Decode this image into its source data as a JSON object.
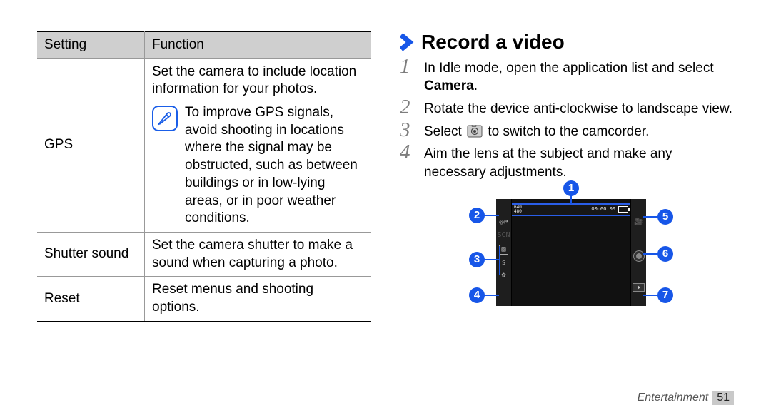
{
  "table": {
    "header_setting": "Setting",
    "header_function": "Function",
    "rows": {
      "gps": {
        "setting": "GPS",
        "func_line": "Set the camera to include location information for your photos.",
        "note": "To improve GPS signals, avoid shooting in locations where the signal may be obstructed, such as between buildings or in low-lying areas, or in poor weather conditions."
      },
      "shutter": {
        "setting": "Shutter sound",
        "func": "Set the camera shutter to make a sound when capturing a photo."
      },
      "reset": {
        "setting": "Reset",
        "func": "Reset menus and shooting options."
      }
    }
  },
  "right": {
    "title": "Record a video",
    "steps": {
      "s1a": "In Idle mode, open the application list and select ",
      "s1b": "Camera",
      "s1c": ".",
      "s2": "Rotate the device anti-clockwise to landscape view.",
      "s3a": "Select ",
      "s3b": " to switch to the camcorder.",
      "s4": "Aim the lens at the subject and make any necessary adjustments."
    },
    "diagram": {
      "top_left": "640\n480",
      "top_timer": "00:00:00",
      "callouts": [
        "1",
        "2",
        "3",
        "4",
        "5",
        "6",
        "7"
      ],
      "scn_label": "SCN",
      "ev_label": "±"
    }
  },
  "footer": {
    "category": "Entertainment",
    "page": "51"
  }
}
